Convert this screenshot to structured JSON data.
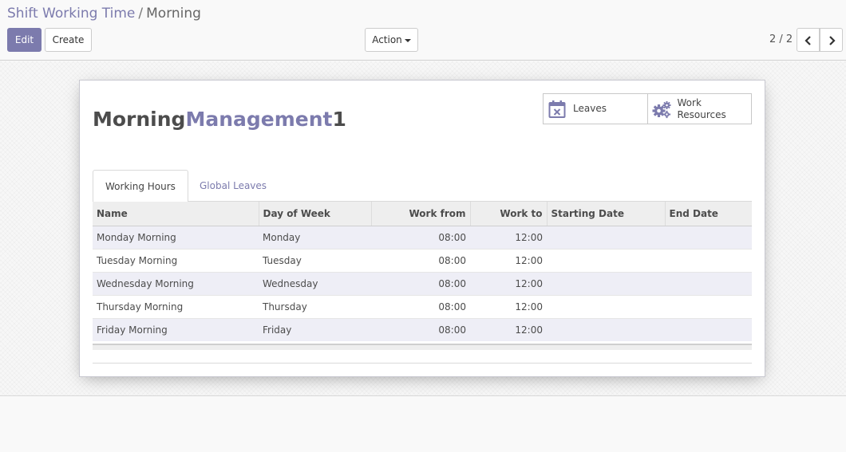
{
  "breadcrumb": {
    "parent": "Shift Working Time",
    "separator": "/",
    "current": "Morning"
  },
  "toolbar": {
    "edit_label": "Edit",
    "create_label": "Create",
    "action_label": "Action"
  },
  "pager": {
    "value": "2 / 2"
  },
  "smart_buttons": {
    "leaves_label": "Leaves",
    "work_resources_label_line1": "Work",
    "work_resources_label_line2": "Resources"
  },
  "record": {
    "title_part1": "Morning",
    "title_part2": "Management",
    "title_part3": "1"
  },
  "tabs": {
    "working_hours": "Working Hours",
    "global_leaves": "Global Leaves"
  },
  "table": {
    "headers": {
      "name": "Name",
      "day": "Day of Week",
      "from": "Work from",
      "to": "Work to",
      "start": "Starting Date",
      "end": "End Date"
    },
    "rows": [
      {
        "name": "Monday Morning",
        "day": "Monday",
        "from": "08:00",
        "to": "12:00",
        "start": "",
        "end": ""
      },
      {
        "name": "Tuesday Morning",
        "day": "Tuesday",
        "from": "08:00",
        "to": "12:00",
        "start": "",
        "end": ""
      },
      {
        "name": "Wednesday Morning",
        "day": "Wednesday",
        "from": "08:00",
        "to": "12:00",
        "start": "",
        "end": ""
      },
      {
        "name": "Thursday Morning",
        "day": "Thursday",
        "from": "08:00",
        "to": "12:00",
        "start": "",
        "end": ""
      },
      {
        "name": "Friday Morning",
        "day": "Friday",
        "from": "08:00",
        "to": "12:00",
        "start": "",
        "end": ""
      }
    ]
  },
  "colors": {
    "accent": "#7c7bad",
    "text": "#4c4c4c",
    "odd_row": "#eeeef6",
    "header_bg": "#eeeeee"
  },
  "icons": {
    "leaves": "calendar-x-icon",
    "work_resources": "gears-icon",
    "pager_prev": "chevron-left-icon",
    "pager_next": "chevron-right-icon",
    "action_caret": "caret-down-icon"
  }
}
